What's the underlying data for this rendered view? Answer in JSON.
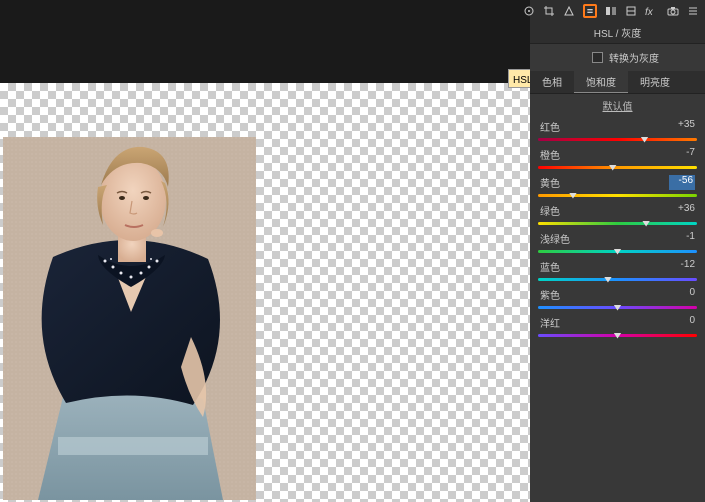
{
  "tooltip": "HSL / 灰度",
  "panel": {
    "title": "HSL / 灰度",
    "convert_checkbox_label": "转换为灰度",
    "tabs": {
      "hue": "色相",
      "saturation": "饱和度",
      "luminance": "明亮度"
    },
    "default_label": "默认值"
  },
  "sliders": [
    {
      "label": "红色",
      "value": "+35",
      "pos": 67,
      "grad": [
        "#a30046",
        "#ff0000",
        "#ff7a00"
      ],
      "sel": false
    },
    {
      "label": "橙色",
      "value": "-7",
      "pos": 47,
      "grad": [
        "#ff0000",
        "#ff9a00",
        "#ffe000"
      ],
      "sel": false
    },
    {
      "label": "黄色",
      "value": "-56",
      "pos": 22,
      "grad": [
        "#ff9a00",
        "#ffe000",
        "#7ad400"
      ],
      "sel": true
    },
    {
      "label": "绿色",
      "value": "+36",
      "pos": 68,
      "grad": [
        "#ffe000",
        "#2ecc40",
        "#00d4c4"
      ],
      "sel": false
    },
    {
      "label": "浅绿色",
      "value": "-1",
      "pos": 50,
      "grad": [
        "#2ecc40",
        "#00d4c4",
        "#1e90ff"
      ],
      "sel": false
    },
    {
      "label": "蓝色",
      "value": "-12",
      "pos": 44,
      "grad": [
        "#00d4c4",
        "#1e90ff",
        "#6a4cff"
      ],
      "sel": false
    },
    {
      "label": "紫色",
      "value": "0",
      "pos": 50,
      "grad": [
        "#1e90ff",
        "#6a4cff",
        "#d400a8"
      ],
      "sel": false
    },
    {
      "label": "洋红",
      "value": "0",
      "pos": 50,
      "grad": [
        "#6a4cff",
        "#d400a8",
        "#ff0000"
      ],
      "sel": false
    }
  ]
}
